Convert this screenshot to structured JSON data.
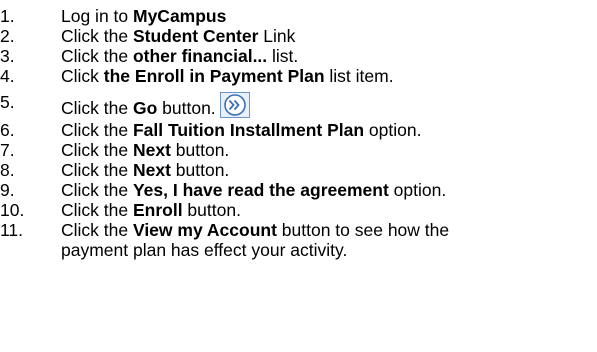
{
  "steps": [
    {
      "num": "1.",
      "parts": [
        "Log in to ",
        "MyCampus",
        ""
      ]
    },
    {
      "num": "2.",
      "parts": [
        "Click the ",
        "Student Center",
        " Link"
      ]
    },
    {
      "num": "3.",
      "parts": [
        "Click the ",
        "other financial...",
        " list."
      ]
    },
    {
      "num": "4.",
      "parts": [
        "Click ",
        "the Enroll in Payment Plan",
        " list item."
      ]
    },
    {
      "num": "5.",
      "parts": [
        "Click the ",
        "Go",
        " button."
      ],
      "icon": "go-button-icon"
    },
    {
      "num": "6.",
      "parts": [
        "Click the ",
        "Fall Tuition Installment Plan",
        " option."
      ]
    },
    {
      "num": "7.",
      "parts": [
        "Click the ",
        "Next",
        " button."
      ]
    },
    {
      "num": "8.",
      "parts": [
        "Click the ",
        "Next",
        " button."
      ]
    },
    {
      "num": "9.",
      "parts": [
        "Click the ",
        "Yes, I have read the agreement",
        " option."
      ]
    },
    {
      "num": "10.",
      "parts": [
        "Click the ",
        "Enroll",
        " button."
      ]
    },
    {
      "num": "11.",
      "parts": [
        "Click the ",
        "View my Account",
        " button to see how the"
      ],
      "continuation": "payment plan has effect your activity."
    }
  ],
  "colors": {
    "text": "#000000",
    "icon_border": "#6f94c9",
    "icon_fill": "#e8f0fb",
    "icon_circle": "#3b6fb6"
  }
}
